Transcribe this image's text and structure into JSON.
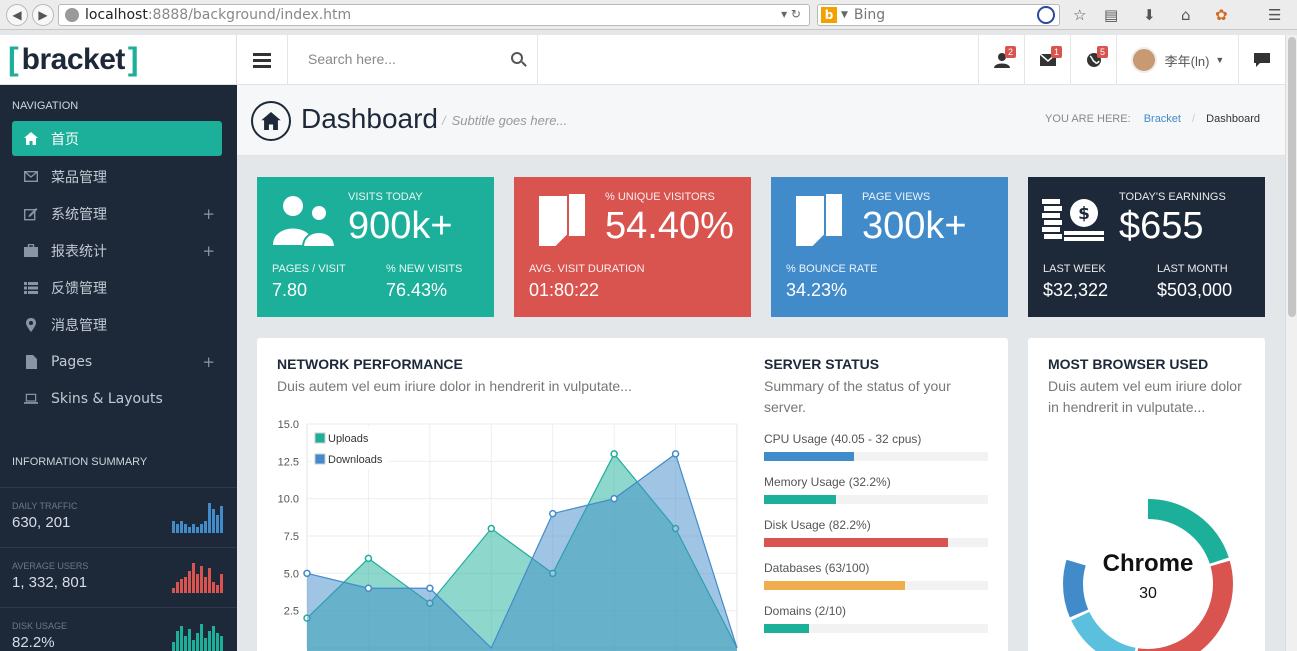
{
  "browser": {
    "url_host": "localhost",
    "url_rest": ":8888/background/index.htm",
    "search_engine": "Bing"
  },
  "logo": {
    "open": "[",
    "word": "bracket",
    "close": "]"
  },
  "sidebar": {
    "nav_title": "NAVIGATION",
    "items": [
      {
        "label": "首页",
        "icon": "home-icon",
        "active": true
      },
      {
        "label": "菜品管理",
        "icon": "envelope-icon"
      },
      {
        "label": "系统管理",
        "icon": "edit-icon",
        "expandable": true
      },
      {
        "label": "报表统计",
        "icon": "briefcase-icon",
        "expandable": true
      },
      {
        "label": "反馈管理",
        "icon": "list-icon"
      },
      {
        "label": "消息管理",
        "icon": "map-marker-icon"
      },
      {
        "label": "Pages",
        "icon": "file-icon",
        "expandable": true
      },
      {
        "label": "Skins & Layouts",
        "icon": "laptop-icon"
      }
    ],
    "plus": "+",
    "info_title": "INFORMATION SUMMARY",
    "summary": [
      {
        "label": "DAILY TRAFFIC",
        "value": "630, 201",
        "color": "#428bca",
        "bars": [
          4,
          3,
          4,
          3,
          2,
          3,
          2,
          3,
          4,
          10,
          8,
          6,
          9
        ]
      },
      {
        "label": "AVERAGE USERS",
        "value": "1, 332, 801",
        "color": "#d9534f",
        "bars": [
          2,
          4,
          5,
          6,
          8,
          11,
          7,
          10,
          6,
          9,
          4,
          3,
          7
        ]
      },
      {
        "label": "DISK USAGE",
        "value": "82.2%",
        "color": "#1caf9a",
        "bars": [
          5,
          10,
          12,
          8,
          11,
          6,
          9,
          13,
          7,
          10,
          12,
          9,
          8
        ]
      }
    ]
  },
  "header": {
    "search_placeholder": "Search here...",
    "badges": {
      "users": "2",
      "messages": "1",
      "alerts": "5"
    },
    "user_name": "李年(ln)"
  },
  "page": {
    "title": "Dashboard",
    "subtitle": "Subtitle goes here...",
    "breadcrumb_prefix": "YOU ARE HERE:",
    "breadcrumb_link": "Bracket",
    "breadcrumb_sep": "/",
    "breadcrumb_current": "Dashboard"
  },
  "tiles": [
    {
      "label": "VISITS TODAY",
      "value": "900k+",
      "s1_label": "PAGES / VISIT",
      "s1_value": "7.80",
      "s2_label": "% NEW VISITS",
      "s2_value": "76.43%",
      "color": "#1caf9a",
      "icon": "users-icon"
    },
    {
      "label": "% UNIQUE VISITORS",
      "value": "54.40%",
      "s1_label": "AVG. VISIT DURATION",
      "s1_value": "01:80:22",
      "s2_label": "",
      "s2_value": "",
      "color": "#d9534f",
      "icon": "documents-icon"
    },
    {
      "label": "PAGE VIEWS",
      "value": "300k+",
      "s1_label": "% BOUNCE RATE",
      "s1_value": "34.23%",
      "s2_label": "",
      "s2_value": "",
      "color": "#428bca",
      "icon": "documents-icon"
    },
    {
      "label": "TODAY'S EARNINGS",
      "value": "$655",
      "s1_label": "LAST WEEK",
      "s1_value": "$32,322",
      "s2_label": "LAST MONTH",
      "s2_value": "$503,000",
      "color": "#1d2939",
      "icon": "money-icon"
    }
  ],
  "network": {
    "title": "NETWORK PERFORMANCE",
    "desc": "Duis autem vel eum iriure dolor in hendrerit in vulputate..."
  },
  "chart_data": {
    "type": "area",
    "x": [
      0,
      1,
      2,
      3,
      4,
      5,
      6,
      7
    ],
    "series": [
      {
        "name": "Uploads",
        "color": "#1caf9a",
        "values": [
          2,
          6,
          3,
          8,
          5,
          13,
          8,
          0
        ]
      },
      {
        "name": "Downloads",
        "color": "#428bca",
        "values": [
          5,
          4,
          4,
          0,
          9,
          10,
          13,
          0
        ]
      }
    ],
    "yticks": [
      "15.0",
      "12.5",
      "10.0",
      "7.5",
      "5.0",
      "2.5"
    ],
    "ylim": [
      0,
      15
    ],
    "grid": true,
    "legend": "top-left"
  },
  "server": {
    "title": "SERVER STATUS",
    "desc": "Summary of the status of your server.",
    "items": [
      {
        "label": "CPU Usage (40.05 - 32 cpus)",
        "pct": 40,
        "color": "#428bca"
      },
      {
        "label": "Memory Usage (32.2%)",
        "pct": 32,
        "color": "#1caf9a"
      },
      {
        "label": "Disk Usage (82.2%)",
        "pct": 82,
        "color": "#d9534f"
      },
      {
        "label": "Databases (63/100)",
        "pct": 63,
        "color": "#f0ad4e"
      },
      {
        "label": "Domains (2/10)",
        "pct": 20,
        "color": "#1caf9a"
      }
    ]
  },
  "browser_panel": {
    "title": "MOST BROWSER USED",
    "desc": "Duis autem vel eum iriure dolor in hendrerit in vulputate...",
    "center_label": "Chrome",
    "center_value": "30"
  }
}
